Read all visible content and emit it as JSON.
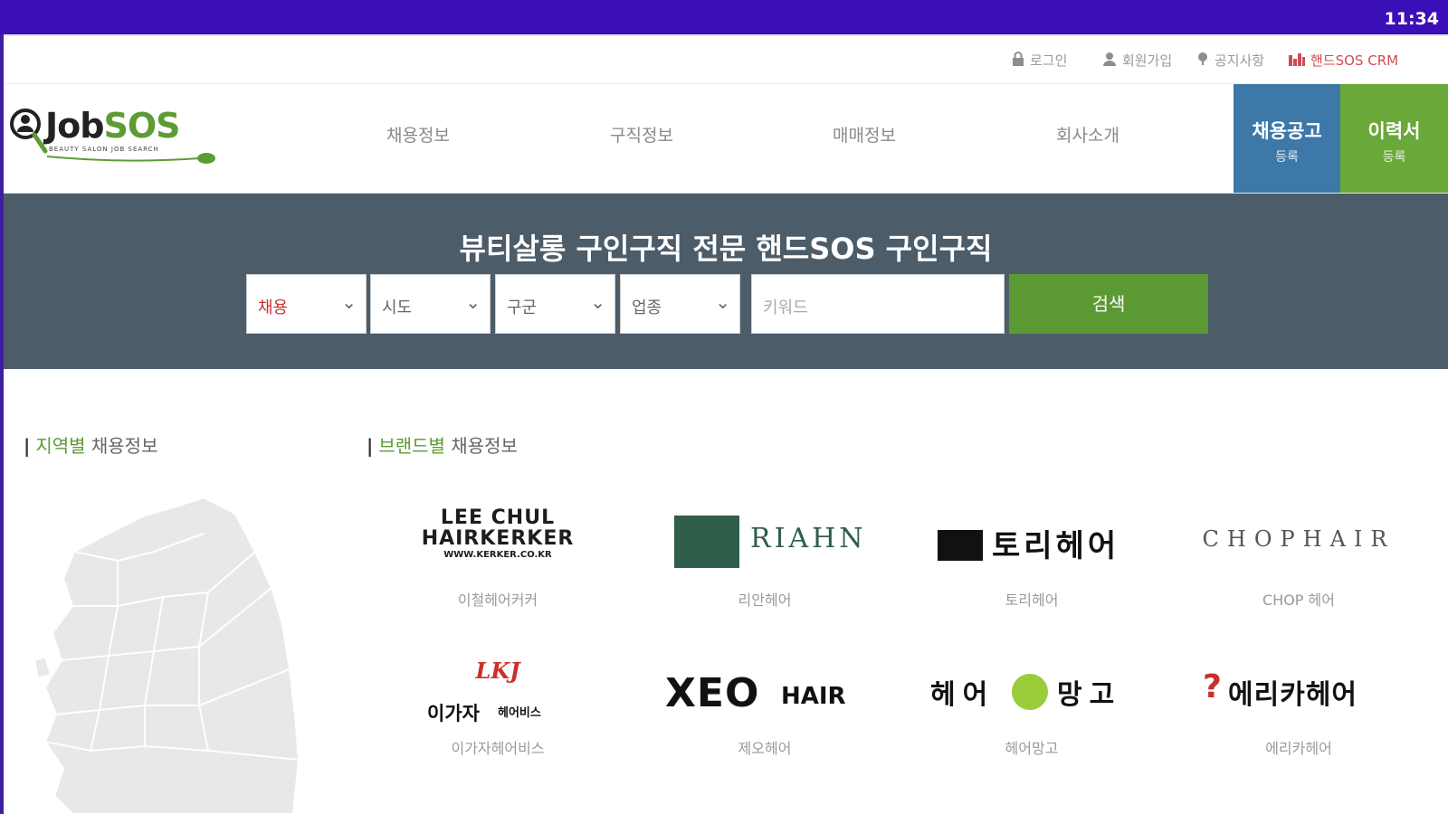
{
  "status_bar": {
    "time": "11:34"
  },
  "util_nav": {
    "login": "로그인",
    "signup": "회원가입",
    "notice": "공지사항",
    "crm": "핸드SOS CRM"
  },
  "header": {
    "logo": "JobSOS",
    "logo_tagline": "BEAUTY SALON JOB SEARCH",
    "nav": [
      "채용정보",
      "구직정보",
      "매매정보",
      "회사소개"
    ],
    "cta_job": {
      "line1": "채용공고",
      "line2": "등록"
    },
    "cta_resume": {
      "line1": "이력서",
      "line2": "등록"
    }
  },
  "hero": {
    "title": "뷰티살롱 구인구직 전문 핸드SOS 구인구직",
    "filters": {
      "type": "채용",
      "sido": "시도",
      "gugun": "구군",
      "industry": "업종"
    },
    "keyword_placeholder": "키워드",
    "search_label": "검색"
  },
  "sections": {
    "region": {
      "highlight": "지역별",
      "rest": "채용정보"
    },
    "brand": {
      "highlight": "브랜드별",
      "rest": "채용정보"
    }
  },
  "brands": [
    {
      "logo_line1": "LEE CHUL",
      "logo_line2": "HAIRKERKER",
      "logo_line3": "WWW.KERKER.CO.KR",
      "name": "이철헤어커커"
    },
    {
      "logo_line1": "RIAHN",
      "logo_line2": "",
      "logo_line3": "",
      "name": "리안헤어"
    },
    {
      "logo_line1": "토리헤어",
      "logo_line2": "",
      "logo_line3": "",
      "name": "토리헤어"
    },
    {
      "logo_line1": "CHOPHAIR",
      "logo_line2": "",
      "logo_line3": "",
      "name": "CHOP 헤어"
    },
    {
      "logo_line1": "LKJ",
      "logo_line2": "이가자",
      "logo_line3": "헤어비스",
      "name": "이가자헤어비스"
    },
    {
      "logo_line1": "XEO",
      "logo_line2": "HAIR",
      "logo_line3": "",
      "name": "제오헤어"
    },
    {
      "logo_line1": "헤어",
      "logo_line2": "망고",
      "logo_line3": "",
      "name": "헤어망고"
    },
    {
      "logo_line1": "에리카헤어",
      "logo_line2": "",
      "logo_line3": "",
      "name": "에리카헤어"
    }
  ],
  "colors": {
    "status_bar": "#3a0fb8",
    "accent_green": "#5b9a33",
    "cta_blue": "#3d78a8",
    "hero_bg": "#4d5c69",
    "crm_red": "#d14a55"
  }
}
